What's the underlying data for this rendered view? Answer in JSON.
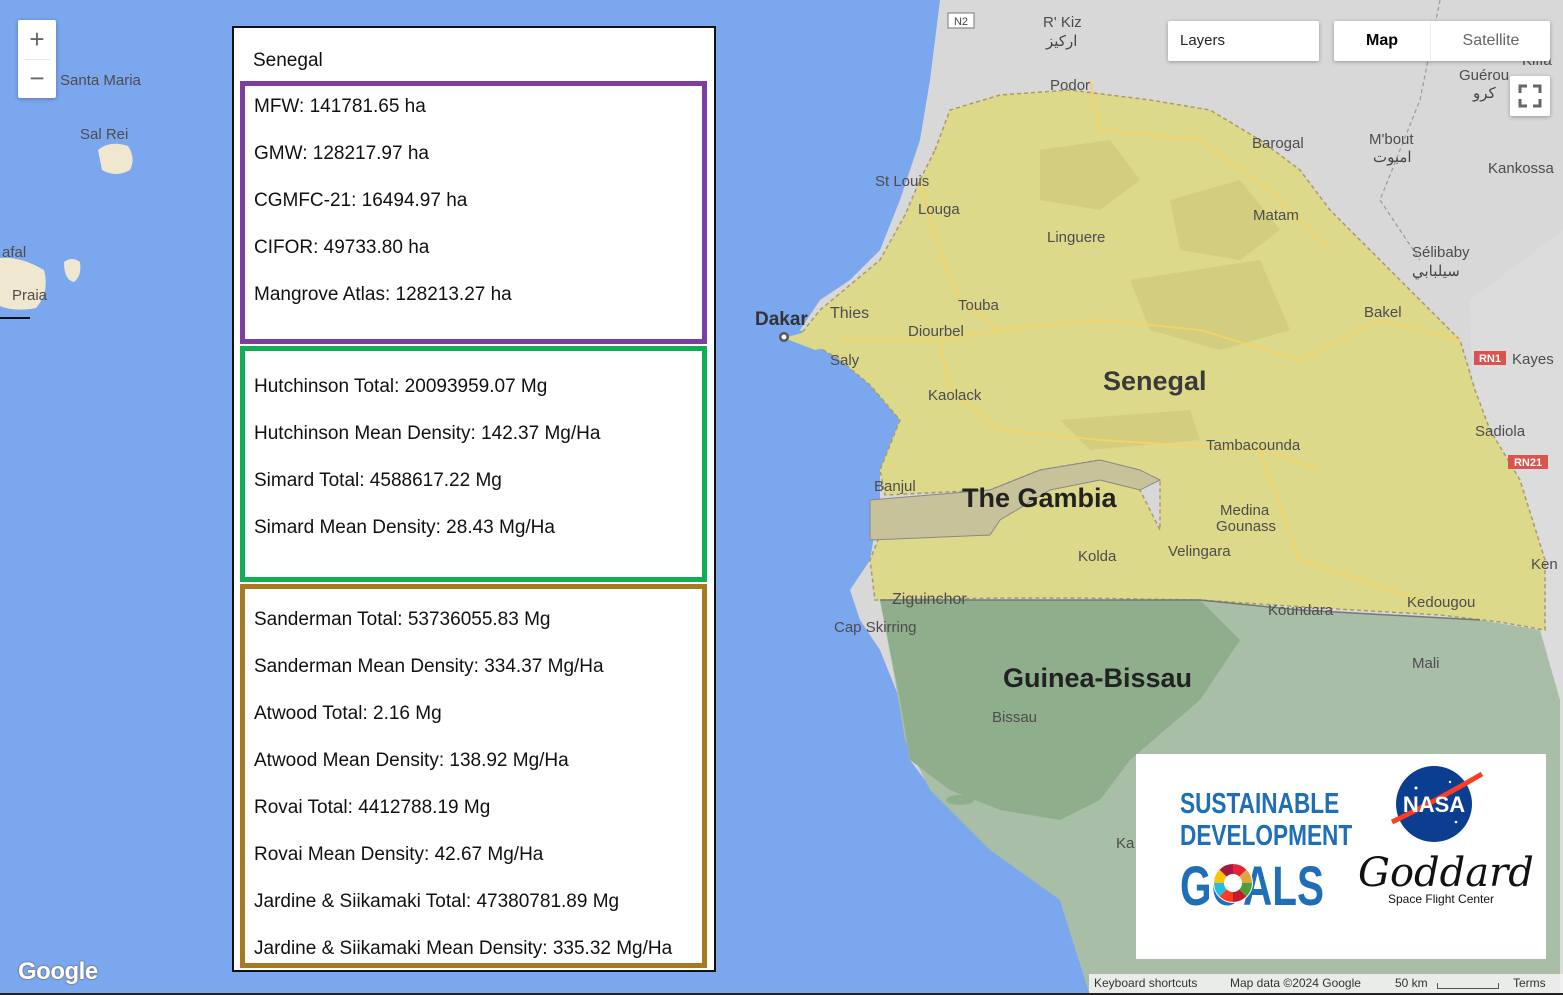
{
  "map": {
    "cities": [
      {
        "name": "Santa Maria"
      },
      {
        "name": "Sal Rei"
      },
      {
        "name": "afal"
      },
      {
        "name": "Praia"
      },
      {
        "name": "R' Kiz"
      },
      {
        "name": "Podor"
      },
      {
        "name": "St Louis"
      },
      {
        "name": "Louga"
      },
      {
        "name": "Linguere"
      },
      {
        "name": "Barogal"
      },
      {
        "name": "Matam"
      },
      {
        "name": "M'bout"
      },
      {
        "name": "Guérou"
      },
      {
        "name": "Kankossa"
      },
      {
        "name": "Sélibaby"
      },
      {
        "name": "Dakar"
      },
      {
        "name": "Thies"
      },
      {
        "name": "Touba"
      },
      {
        "name": "Diourbel"
      },
      {
        "name": "Saly"
      },
      {
        "name": "Bakel"
      },
      {
        "name": "Kayes"
      },
      {
        "name": "Kaolack"
      },
      {
        "name": "Tambacounda"
      },
      {
        "name": "Sadiola"
      },
      {
        "name": "Banjul"
      },
      {
        "name": "Medina"
      },
      {
        "name": "Gounass"
      },
      {
        "name": "Velingara"
      },
      {
        "name": "Kolda"
      },
      {
        "name": "Ziguinchor"
      },
      {
        "name": "Cap Skirring"
      },
      {
        "name": "Koundara"
      },
      {
        "name": "Kedougou"
      },
      {
        "name": "Mali"
      },
      {
        "name": "Bissau"
      },
      {
        "name": "Kiffa"
      },
      {
        "name": "Ka"
      },
      {
        "name": "Ken"
      }
    ],
    "arabic_labels": [
      "اركيز",
      "كرو",
      "امبوت",
      "سيلبابي"
    ],
    "countries": [
      "Senegal",
      "The Gambia",
      "Guinea-Bissau"
    ],
    "road_shields": [
      "N2",
      "RN1",
      "RN21"
    ],
    "colors": {
      "ocean": "#7ba7ee",
      "senegal": "#dcd98a",
      "land": "#d8d8d8",
      "guinea_bissau": "#9cb898",
      "gambia": "#c8c29a"
    }
  },
  "zoom": {
    "in_label": "+",
    "out_label": "−"
  },
  "info_panel": {
    "title": "Senegal",
    "area_group": {
      "color": "#7a3fa0",
      "items": [
        "MFW: 141781.65 ha",
        "GMW: 128217.97 ha",
        "CGMFC-21: 16494.97 ha",
        "CIFOR: 49733.80 ha",
        "Mangrove Atlas: 128213.27 ha"
      ]
    },
    "biomass_group": {
      "color": "#12ad57",
      "items": [
        "Hutchinson Total: 20093959.07 Mg",
        "Hutchinson Mean Density: 142.37 Mg/Ha",
        "Simard Total: 4588617.22 Mg",
        "Simard Mean Density: 28.43 Mg/Ha"
      ]
    },
    "soil_group": {
      "color": "#a97920",
      "items": [
        "Sanderman Total: 53736055.83 Mg",
        "Sanderman Mean Density: 334.37 Mg/Ha",
        "Atwood Total: 2.16 Mg",
        "Atwood Mean Density: 138.92 Mg/Ha",
        "Rovai Total: 4412788.19 Mg",
        "Rovai Mean Density: 42.67 Mg/Ha",
        "Jardine & Siikamaki Total: 47380781.89 Mg",
        "Jardine & Siikamaki Mean Density: 335.32 Mg/Ha"
      ]
    }
  },
  "controls": {
    "layers_label": "Layers",
    "map_label": "Map",
    "satellite_label": "Satellite",
    "selected_map_type": "Map"
  },
  "logos": {
    "sdg_line1": "SUSTAINABLE",
    "sdg_line2": "DEVELOPMENT",
    "sdg_line3": "GOALS",
    "nasa": "NASA",
    "goddard": "Goddard",
    "goddard_sub": "Space Flight Center"
  },
  "footer": {
    "google_logo": "Google",
    "keyboard_shortcuts": "Keyboard shortcuts",
    "map_data": "Map data ©2024 Google",
    "scale": "50 km",
    "terms": "Terms"
  }
}
